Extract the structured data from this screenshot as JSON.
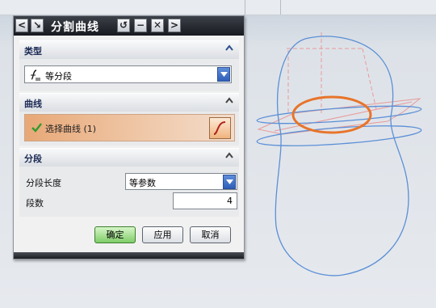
{
  "dialog": {
    "title": "分割曲线",
    "titlebar_buttons": {
      "back": "<",
      "pin": "↘",
      "reset": "↺",
      "minimize": "−",
      "close": "✕",
      "forward": ">"
    },
    "sections": {
      "type": {
        "header": "类型",
        "selected": "等分段"
      },
      "curve": {
        "header": "曲线",
        "select_label": "选择曲线 (1)"
      },
      "segments": {
        "header": "分段",
        "length_label": "分段长度",
        "length_value": "等参数",
        "count_label": "段数",
        "count_value": "4"
      }
    },
    "buttons": {
      "ok": "确定",
      "apply": "应用",
      "cancel": "取消"
    }
  },
  "colors": {
    "curve_highlight": "#e8742a",
    "geometry_blue": "#5b8fd6",
    "construction_pink": "#e89a9a",
    "ok_button": "#7fcd68"
  }
}
